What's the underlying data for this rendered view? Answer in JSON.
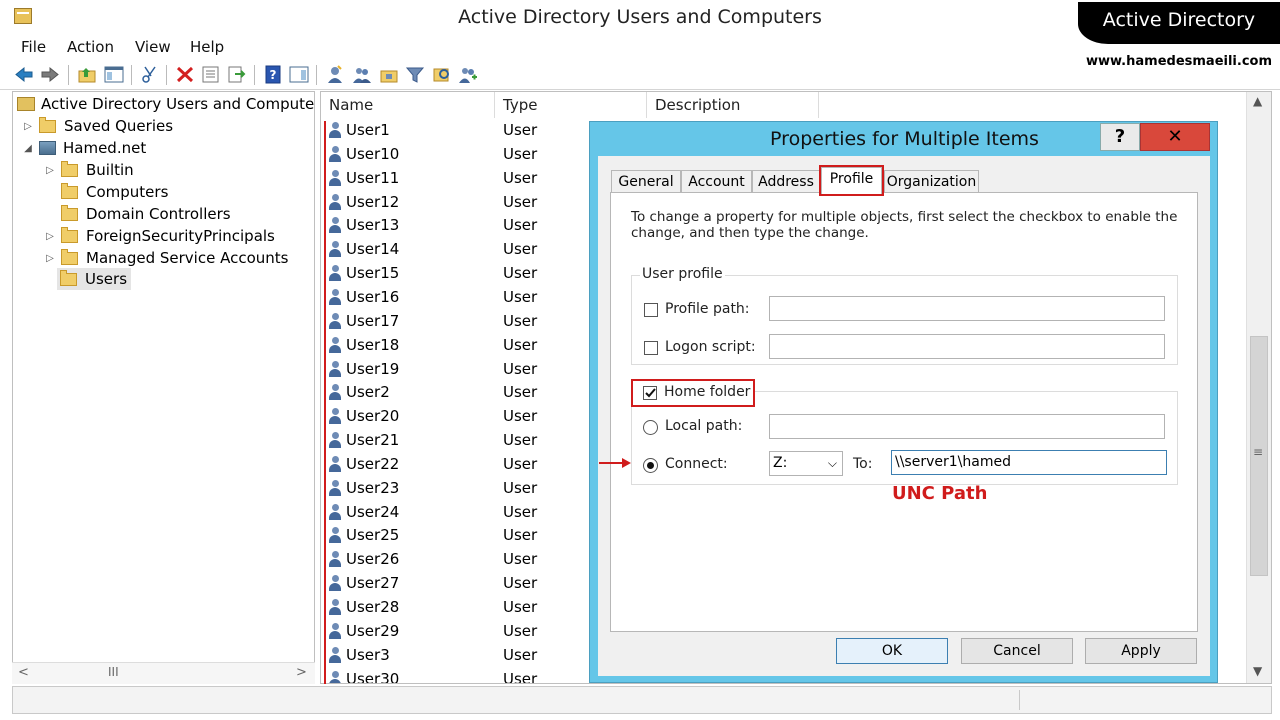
{
  "window": {
    "title": "Active Directory Users and Computers"
  },
  "brand": {
    "title": "Active Directory",
    "url": "www.hamedesmaeili.com"
  },
  "menu": [
    "File",
    "Action",
    "View",
    "Help"
  ],
  "tree": {
    "root": "Active Directory Users and Compute",
    "saved_queries": "Saved Queries",
    "domain": "Hamed.net",
    "children": [
      "Builtin",
      "Computers",
      "Domain Controllers",
      "ForeignSecurityPrincipals",
      "Managed Service Accounts",
      "Users"
    ],
    "hscroll_grip": "III"
  },
  "list": {
    "columns": [
      "Name",
      "Type",
      "Description"
    ],
    "rows": [
      {
        "name": "User1",
        "type": "User"
      },
      {
        "name": "User10",
        "type": "User"
      },
      {
        "name": "User11",
        "type": "User"
      },
      {
        "name": "User12",
        "type": "User"
      },
      {
        "name": "User13",
        "type": "User"
      },
      {
        "name": "User14",
        "type": "User"
      },
      {
        "name": "User15",
        "type": "User"
      },
      {
        "name": "User16",
        "type": "User"
      },
      {
        "name": "User17",
        "type": "User"
      },
      {
        "name": "User18",
        "type": "User"
      },
      {
        "name": "User19",
        "type": "User"
      },
      {
        "name": "User2",
        "type": "User"
      },
      {
        "name": "User20",
        "type": "User"
      },
      {
        "name": "User21",
        "type": "User"
      },
      {
        "name": "User22",
        "type": "User"
      },
      {
        "name": "User23",
        "type": "User"
      },
      {
        "name": "User24",
        "type": "User"
      },
      {
        "name": "User25",
        "type": "User"
      },
      {
        "name": "User26",
        "type": "User"
      },
      {
        "name": "User27",
        "type": "User"
      },
      {
        "name": "User28",
        "type": "User"
      },
      {
        "name": "User29",
        "type": "User"
      },
      {
        "name": "User3",
        "type": "User"
      },
      {
        "name": "User30",
        "type": "User"
      }
    ]
  },
  "dialog": {
    "title": "Properties for Multiple Items",
    "help": "?",
    "close": "✕",
    "tabs": [
      "General",
      "Account",
      "Address",
      "Profile",
      "Organization"
    ],
    "intro": "To change a property for multiple objects, first select the checkbox to enable the change, and then type the change.",
    "user_profile": {
      "label": "User profile",
      "profile_path_label": "Profile path:",
      "logon_script_label": "Logon script:",
      "profile_path_value": "",
      "logon_script_value": ""
    },
    "home_folder": {
      "label": "Home folder",
      "local_path_label": "Local path:",
      "connect_label": "Connect:",
      "drive": "Z:",
      "to_label": "To:",
      "unc_value": "\\\\server1\\hamed",
      "local_path_value": ""
    },
    "annotation": "UNC Path",
    "buttons": {
      "ok": "OK",
      "cancel": "Cancel",
      "apply": "Apply"
    }
  },
  "colors": {
    "accent_red": "#d01c1c",
    "dialog_frame": "#65c6e8",
    "close_button": "#d9483b"
  }
}
